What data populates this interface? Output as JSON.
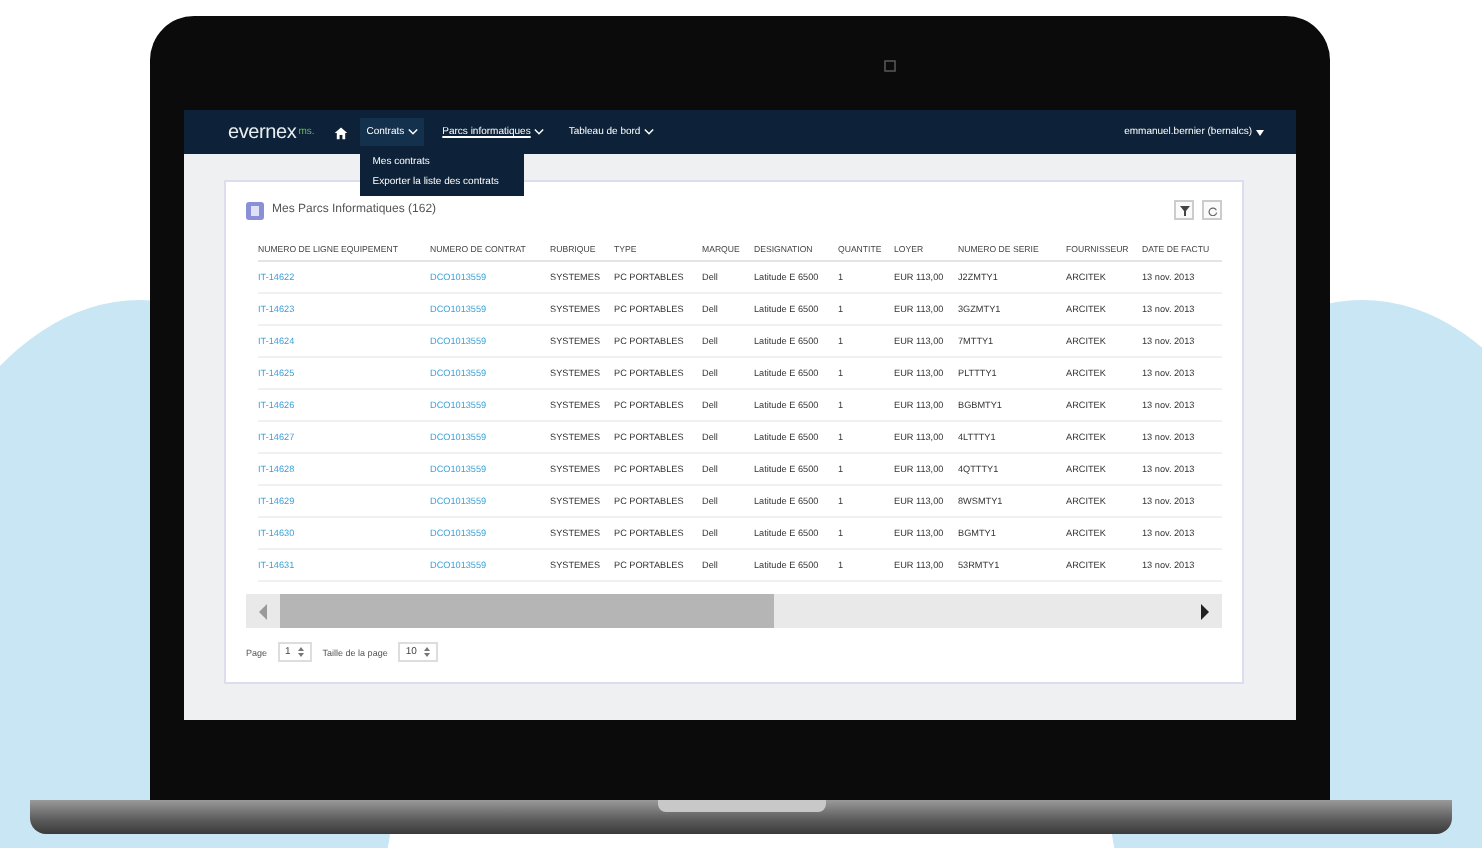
{
  "nav": {
    "logo": "evernex",
    "logo_suffix": "ms.",
    "items": [
      {
        "label": "Contrats",
        "selected": false,
        "expanded": true,
        "menu": [
          "Mes contrats",
          "Exporter la liste des contrats"
        ]
      },
      {
        "label": "Parcs informatiques",
        "selected": true,
        "expanded": false
      },
      {
        "label": "Tableau de bord",
        "selected": false,
        "expanded": false
      }
    ],
    "user": "emmanuel.bernier (bernalcs)"
  },
  "card": {
    "title": "Mes Parcs Informatiques (162)"
  },
  "table": {
    "columns": [
      {
        "label": "NUMERO DE LIGNE EQUIPEMENT",
        "kind": "link"
      },
      {
        "label": "NUMERO DE CONTRAT",
        "kind": "link"
      },
      {
        "label": "RUBRIQUE",
        "kind": "text"
      },
      {
        "label": "TYPE",
        "kind": "text"
      },
      {
        "label": "MARQUE",
        "kind": "text"
      },
      {
        "label": "DESIGNATION",
        "kind": "text"
      },
      {
        "label": "QUANTITE",
        "kind": "text"
      },
      {
        "label": "LOYER",
        "kind": "text"
      },
      {
        "label": "NUMERO DE SERIE",
        "kind": "text"
      },
      {
        "label": "FOURNISSEUR",
        "kind": "text"
      },
      {
        "label": "DATE DE FACTU",
        "kind": "text"
      }
    ],
    "rows": [
      [
        "IT-14622",
        "DCO1013559",
        "SYSTEMES",
        "PC PORTABLES",
        "Dell",
        "Latitude E 6500",
        "1",
        "EUR 113,00",
        "J2ZMTY1",
        "ARCITEK",
        "13 nov. 2013"
      ],
      [
        "IT-14623",
        "DCO1013559",
        "SYSTEMES",
        "PC PORTABLES",
        "Dell",
        "Latitude E 6500",
        "1",
        "EUR 113,00",
        "3GZMTY1",
        "ARCITEK",
        "13 nov. 2013"
      ],
      [
        "IT-14624",
        "DCO1013559",
        "SYSTEMES",
        "PC PORTABLES",
        "Dell",
        "Latitude E 6500",
        "1",
        "EUR 113,00",
        "7MTTY1",
        "ARCITEK",
        "13 nov. 2013"
      ],
      [
        "IT-14625",
        "DCO1013559",
        "SYSTEMES",
        "PC PORTABLES",
        "Dell",
        "Latitude E 6500",
        "1",
        "EUR 113,00",
        "PLTTTY1",
        "ARCITEK",
        "13 nov. 2013"
      ],
      [
        "IT-14626",
        "DCO1013559",
        "SYSTEMES",
        "PC PORTABLES",
        "Dell",
        "Latitude E 6500",
        "1",
        "EUR 113,00",
        "BGBMTY1",
        "ARCITEK",
        "13 nov. 2013"
      ],
      [
        "IT-14627",
        "DCO1013559",
        "SYSTEMES",
        "PC PORTABLES",
        "Dell",
        "Latitude E 6500",
        "1",
        "EUR 113,00",
        "4LTTTY1",
        "ARCITEK",
        "13 nov. 2013"
      ],
      [
        "IT-14628",
        "DCO1013559",
        "SYSTEMES",
        "PC PORTABLES",
        "Dell",
        "Latitude E 6500",
        "1",
        "EUR 113,00",
        "4QTTTY1",
        "ARCITEK",
        "13 nov. 2013"
      ],
      [
        "IT-14629",
        "DCO1013559",
        "SYSTEMES",
        "PC PORTABLES",
        "Dell",
        "Latitude E 6500",
        "1",
        "EUR 113,00",
        "8WSMTY1",
        "ARCITEK",
        "13 nov. 2013"
      ],
      [
        "IT-14630",
        "DCO1013559",
        "SYSTEMES",
        "PC PORTABLES",
        "Dell",
        "Latitude E 6500",
        "1",
        "EUR 113,00",
        "BGMTY1",
        "ARCITEK",
        "13 nov. 2013"
      ],
      [
        "IT-14631",
        "DCO1013559",
        "SYSTEMES",
        "PC PORTABLES",
        "Dell",
        "Latitude E 6500",
        "1",
        "EUR 113,00",
        "53RMTY1",
        "ARCITEK",
        "13 nov. 2013"
      ]
    ]
  },
  "pagination": {
    "page_label": "Page",
    "page_value": "1",
    "size_label": "Taille de la page",
    "size_value": "10"
  }
}
